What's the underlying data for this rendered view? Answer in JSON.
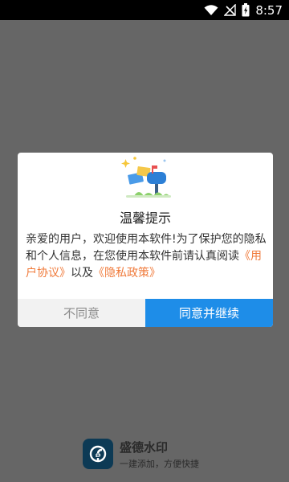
{
  "status_bar": {
    "time": "8:57",
    "icons": [
      "wifi-icon",
      "signal-off-icon",
      "battery-charging-icon"
    ]
  },
  "dialog": {
    "title": "温馨提示",
    "body_prefix": "亲爱的用户，欢迎使用本软件!为了保护您的隐私和个人信息，在您使用本软件前请认真阅读",
    "user_agreement_link": "《用户协议》",
    "connector": "以及",
    "privacy_policy_link": "《隐私政策》",
    "disagree_label": "不同意",
    "agree_label": "同意并继续",
    "colors": {
      "link": "#f07a3a",
      "agree_button": "#1e8de8",
      "disagree_button": "#f2f2f2"
    }
  },
  "app": {
    "name": "盛德水印",
    "slogan": "一建添加，方便快捷",
    "logo_icon": "watermark-logo-icon"
  },
  "colors": {
    "overlay": "#666666",
    "status_bar": "#000000",
    "brand_dark": "#0d4563"
  }
}
